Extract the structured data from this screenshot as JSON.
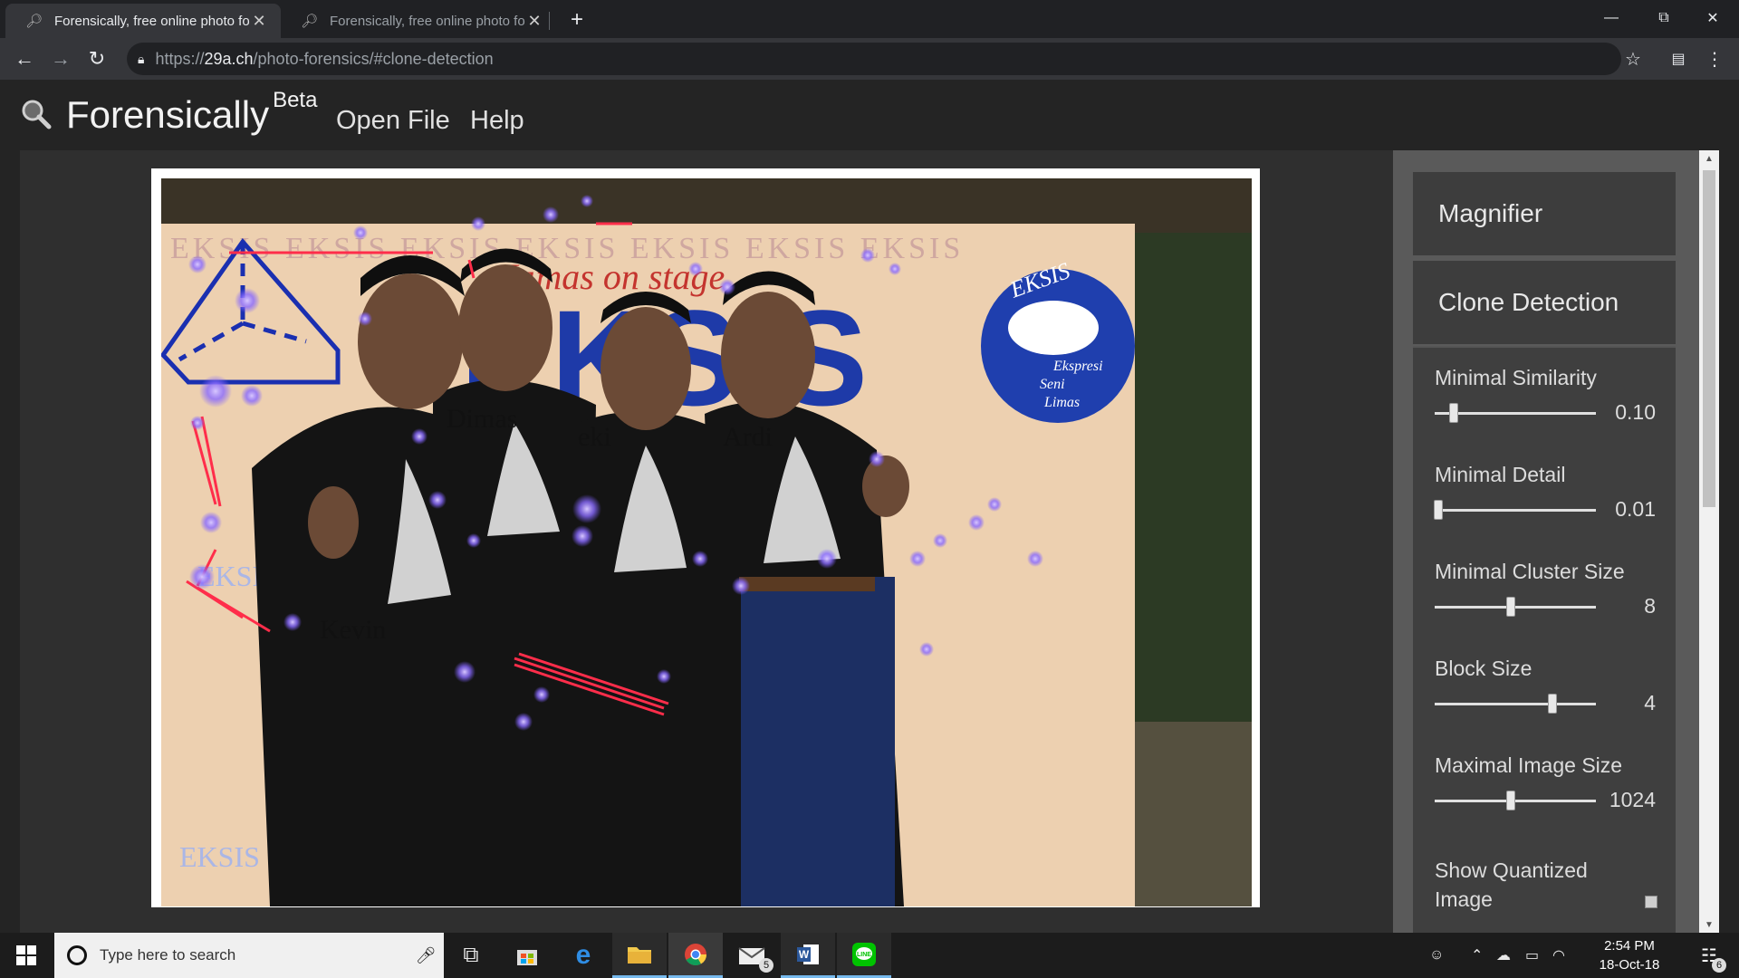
{
  "browser": {
    "tabs": [
      {
        "title": "Forensically, free online photo forensic tools",
        "active": true
      },
      {
        "title": "Forensically, free online photo forensic tools",
        "active": false
      }
    ],
    "url_scheme": "https://",
    "url_host": "29a.ch",
    "url_path": "/photo-forensics/#clone-detection",
    "new_tab_label": "+"
  },
  "app": {
    "brand": "Forensically",
    "brand_sup": "Beta",
    "nav": [
      "Open File",
      "Help"
    ]
  },
  "photo": {
    "overlay_names": [
      "Dimas",
      "eki",
      "Ardi",
      "Kevin"
    ],
    "banner_text": "EKSIS",
    "banner_script": "Limas on stage",
    "logo_script": [
      "Ekspresi",
      "Seni",
      "Limas"
    ],
    "logo_arc": "EKSIS"
  },
  "panel": {
    "sections": [
      "Magnifier",
      "Clone Detection"
    ],
    "controls": [
      {
        "label": "Minimal Similarity",
        "value": "0.10",
        "position": 0.12
      },
      {
        "label": "Minimal Detail",
        "value": "0.01",
        "position": 0.02
      },
      {
        "label": "Minimal Cluster Size",
        "value": "8",
        "position": 0.47
      },
      {
        "label": "Block Size",
        "value": "4",
        "position": 0.73
      },
      {
        "label": "Maximal Image Size",
        "value": "1024",
        "position": 0.47
      }
    ],
    "checkbox": {
      "label": "Show Quantized Image",
      "checked": false
    }
  },
  "taskbar": {
    "search_placeholder": "Type here to search",
    "mail_badge": "5",
    "time": "2:54 PM",
    "date": "18-Oct-18",
    "notification_count": "6"
  },
  "colors": {
    "accent_chrome": "#35363a",
    "clone_line": "#ff2d4a",
    "clone_dot": "#7a5cff",
    "shape_blue": "#1a2fb0"
  }
}
